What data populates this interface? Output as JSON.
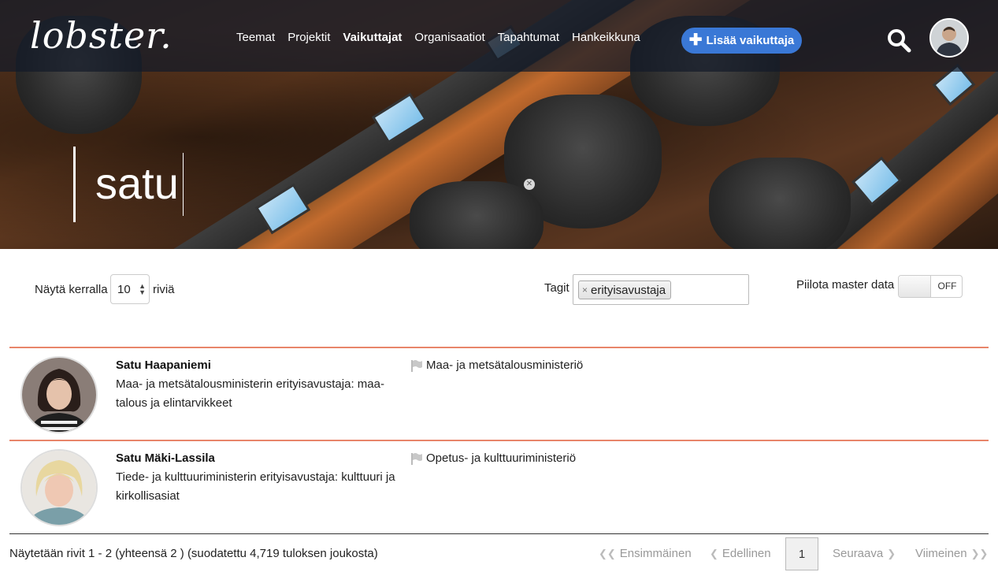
{
  "app": {
    "logo_text": "lobster."
  },
  "nav": {
    "items": [
      {
        "label": "Teemat",
        "active": false
      },
      {
        "label": "Projektit",
        "active": false
      },
      {
        "label": "Vaikuttajat",
        "active": true
      },
      {
        "label": "Organisaatiot",
        "active": false
      },
      {
        "label": "Tapahtumat",
        "active": false
      },
      {
        "label": "Hankeikkuna",
        "active": false
      }
    ],
    "add_button_label": "Lisää vaikuttaja",
    "add_button_icon": "plus-icon",
    "search_icon": "search-icon",
    "avatar_icon": "user-avatar"
  },
  "search": {
    "query": "satu",
    "clear_icon": "clear-icon"
  },
  "controls": {
    "show_label": "Näytä kerralla",
    "page_size": "10",
    "rows_label": "riviä",
    "tags_label": "Tagit",
    "tags": [
      "erityisavustaja"
    ],
    "tag_remove_glyph": "×",
    "hide_master_label": "Piilota master data",
    "hide_master_state": "OFF"
  },
  "results": [
    {
      "name": "Satu Haapaniemi",
      "title": "Maa- ja metsätalousministerin erityisavustaja: maa-talous ja elintarvikkeet",
      "organization": "Maa- ja metsätalousministeriö"
    },
    {
      "name": "Satu Mäki-Lassila",
      "title": "Tiede- ja kulttuuriministerin erityisavustaja: kulttuuri ja kirkollisasiat",
      "organization": "Opetus- ja kulttuuriministeriö"
    }
  ],
  "footer": {
    "info": "Näytetään rivit 1 - 2 (yhteensä 2 ) (suodatettu 4,719 tuloksen joukosta)",
    "first": "Ensimmäinen",
    "prev": "Edellinen",
    "current_page": "1",
    "next": "Seuraava",
    "last": "Viimeinen"
  },
  "colors": {
    "accent": "#3a78d6",
    "row_divider": "#e8856a",
    "nav_overlay": "#141a28"
  }
}
